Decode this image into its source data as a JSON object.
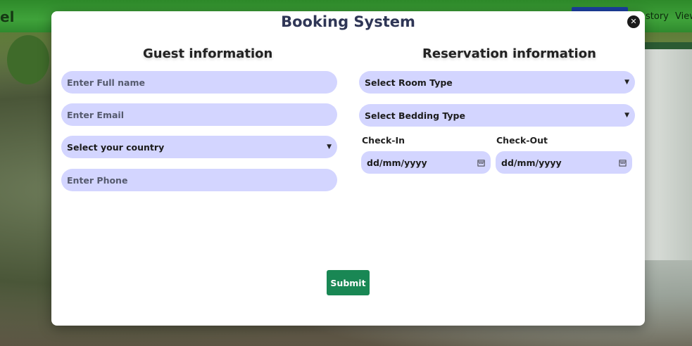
{
  "background": {
    "logo_fragment": "el",
    "nav_links": [
      "story",
      "View"
    ]
  },
  "modal": {
    "title": "Booking System",
    "close_icon": "close-icon",
    "guest": {
      "title": "Guest information",
      "full_name_placeholder": "Enter Full name",
      "email_placeholder": "Enter Email",
      "country_select": "Select your country",
      "phone_placeholder": "Enter Phone"
    },
    "reservation": {
      "title": "Reservation information",
      "room_type_select": "Select Room Type",
      "bedding_type_select": "Select Bedding Type",
      "checkin_label": "Check-In",
      "checkin_value": "dd/mm/yyyy",
      "checkout_label": "Check-Out",
      "checkout_value": "dd/mm/yyyy"
    },
    "submit_label": "Submit"
  },
  "colors": {
    "field_bg": "#d3d5ff",
    "submit_bg": "#198754",
    "title_color": "#2f3656"
  }
}
